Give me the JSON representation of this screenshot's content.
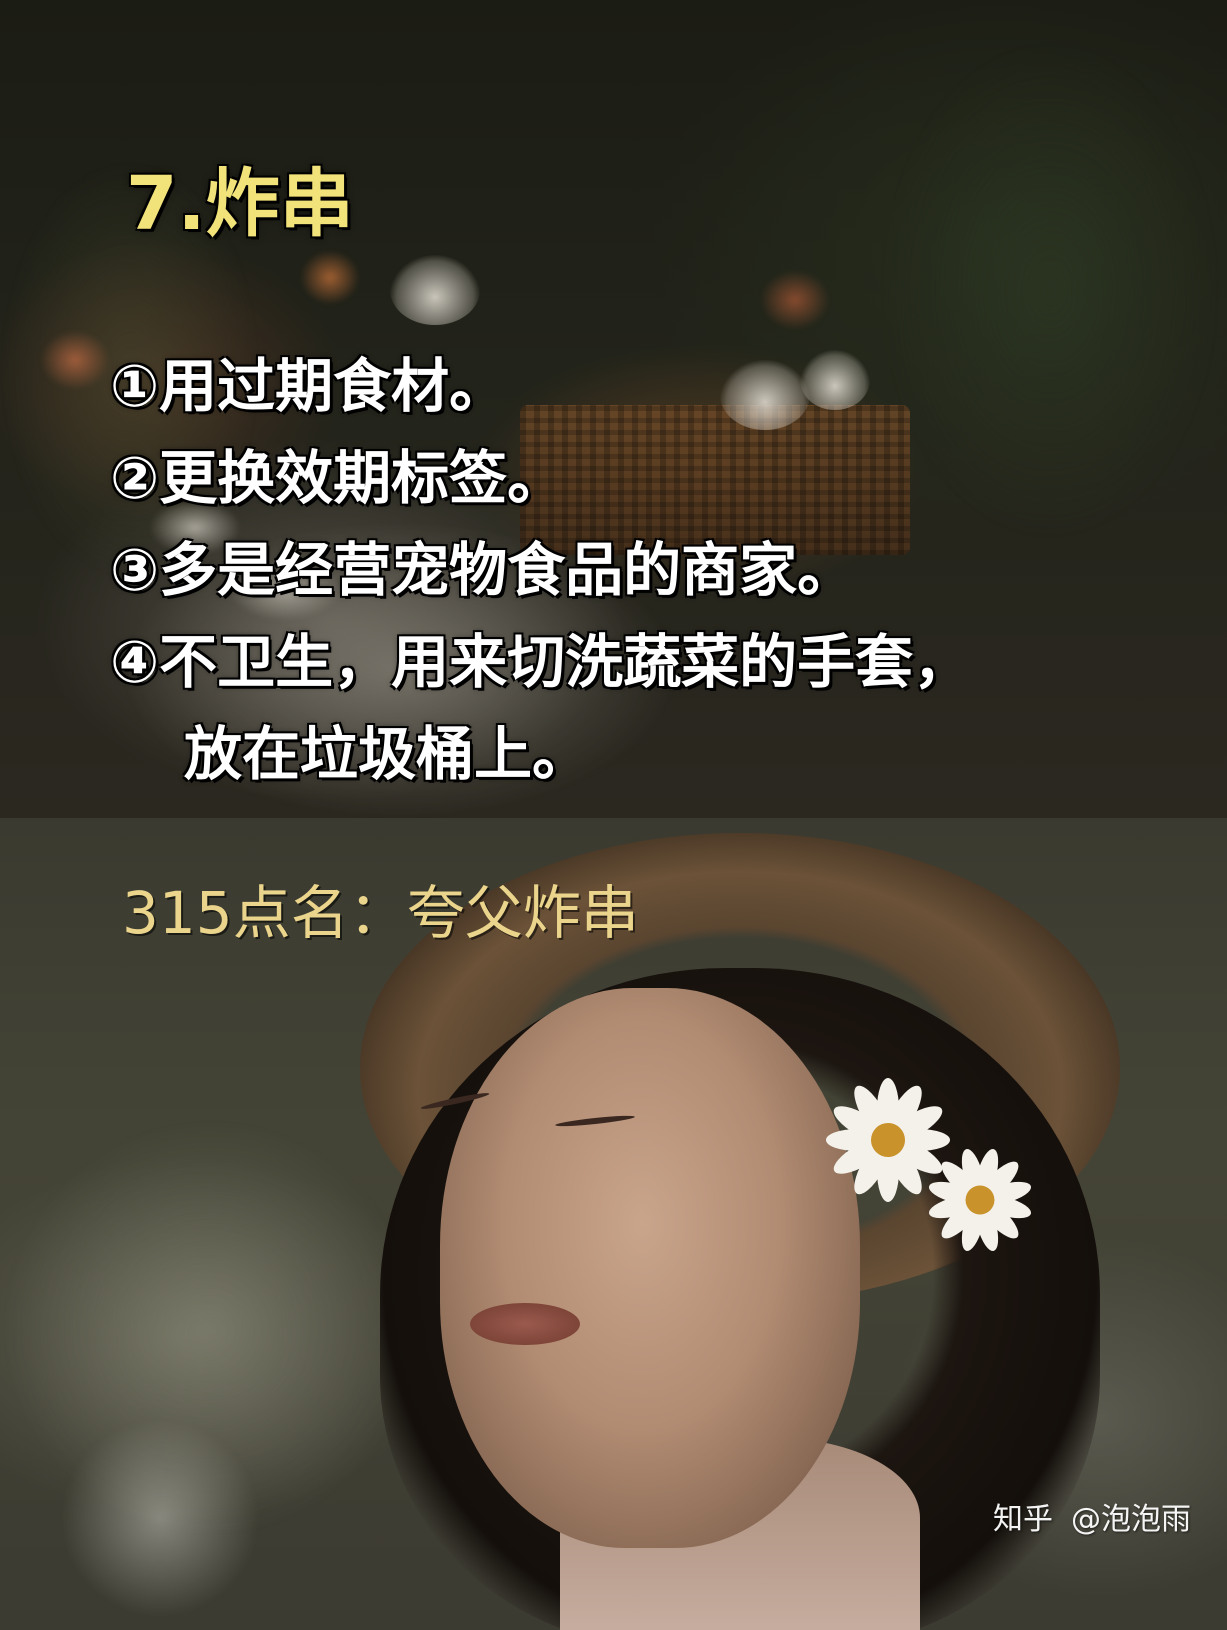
{
  "title": "7.炸串",
  "points": [
    {
      "text": "①用过期食材。"
    },
    {
      "text": "②更换效期标签。"
    },
    {
      "text": "③多是经营宠物食品的商家。"
    },
    {
      "text": "④不卫生，用来切洗蔬菜的手套，",
      "continuation": "放在垃圾桶上。"
    }
  ],
  "caption": "315点名：夸父炸串",
  "watermark": {
    "logo": "知乎",
    "author": "@泡泡雨"
  },
  "colors": {
    "title": "#f1e27a",
    "caption": "#ebd58c",
    "body_text": "#ffffff"
  }
}
